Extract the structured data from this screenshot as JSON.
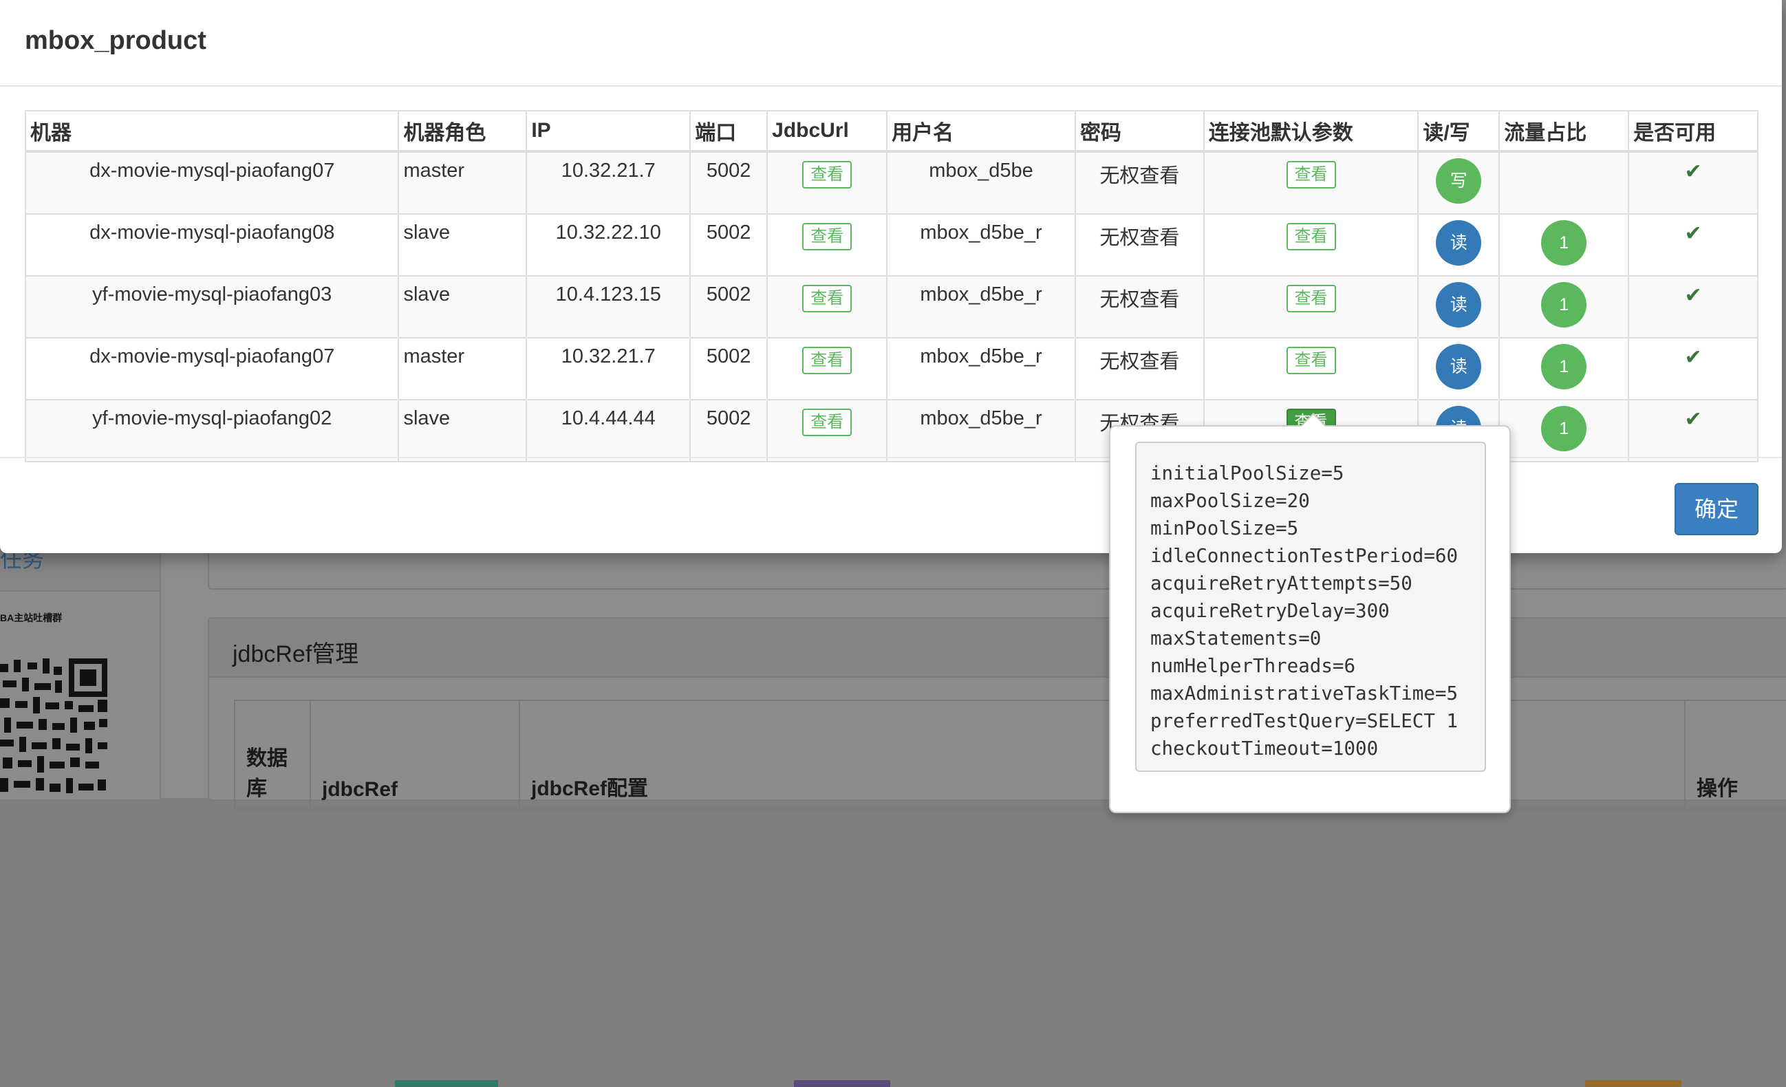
{
  "modal": {
    "title": "mbox_product",
    "ok_label": "确定"
  },
  "table": {
    "headers": [
      "机器",
      "机器角色",
      "IP",
      "端口",
      "JdbcUrl",
      "用户名",
      "密码",
      "连接池默认参数",
      "读/写",
      "流量占比",
      "是否可用"
    ],
    "view_label": "查看",
    "rows": [
      {
        "machine": "dx-movie-mysql-piaofang07",
        "role": "master",
        "ip": "10.32.21.7",
        "port": "5002",
        "username": "mbox_d5be",
        "password": "无权查看",
        "rw": "写",
        "traffic": "",
        "available": "✔"
      },
      {
        "machine": "dx-movie-mysql-piaofang08",
        "role": "slave",
        "ip": "10.32.22.10",
        "port": "5002",
        "username": "mbox_d5be_r",
        "password": "无权查看",
        "rw": "读",
        "traffic": "1",
        "available": "✔"
      },
      {
        "machine": "yf-movie-mysql-piaofang03",
        "role": "slave",
        "ip": "10.4.123.15",
        "port": "5002",
        "username": "mbox_d5be_r",
        "password": "无权查看",
        "rw": "读",
        "traffic": "1",
        "available": "✔"
      },
      {
        "machine": "dx-movie-mysql-piaofang07",
        "role": "master",
        "ip": "10.32.21.7",
        "port": "5002",
        "username": "mbox_d5be_r",
        "password": "无权查看",
        "rw": "读",
        "traffic": "1",
        "available": "✔"
      },
      {
        "machine": "yf-movie-mysql-piaofang02",
        "role": "slave",
        "ip": "10.4.44.44",
        "port": "5002",
        "username": "mbox_d5be_r",
        "password": "无权查看",
        "rw": "读",
        "traffic": "1",
        "available": "✔"
      }
    ]
  },
  "popover": {
    "lines": [
      "initialPoolSize=5",
      "maxPoolSize=20",
      "minPoolSize=5",
      "idleConnectionTestPeriod=60",
      "acquireRetryAttempts=50",
      "acquireRetryDelay=300",
      "maxStatements=0",
      "numHelperThreads=6",
      "maxAdministrativeTaskTime=5",
      "preferredTestQuery=SELECT 1",
      "checkoutTimeout=1000"
    ]
  },
  "background": {
    "sidebar_link": "任务",
    "qr_caption": "BA主站吐槽群",
    "panel_title": "jdbcRef管理",
    "table_headers": [
      "数据库",
      "jdbcRef",
      "jdbcRef配置",
      "操作"
    ]
  },
  "colors": {
    "primary": "#337ab7",
    "success": "#5cb85c",
    "check": "#3c763d"
  }
}
